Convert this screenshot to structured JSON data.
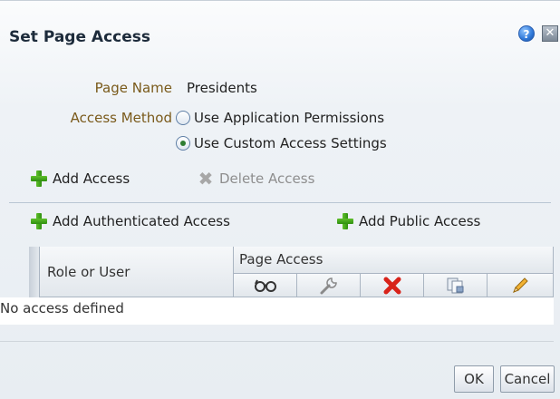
{
  "dialog": {
    "title": "Set Page Access",
    "help_icon": "question-mark-icon",
    "close_icon": "close-icon"
  },
  "form": {
    "page_name_label": "Page Name",
    "page_name_value": "Presidents",
    "access_method_label": "Access Method",
    "options": [
      {
        "label": "Use Application Permissions",
        "selected": false
      },
      {
        "label": "Use Custom Access Settings",
        "selected": true
      }
    ]
  },
  "toolbar": {
    "add_access": "Add Access",
    "delete_access": "Delete Access",
    "delete_enabled": false,
    "add_authenticated": "Add Authenticated Access",
    "add_public": "Add Public Access"
  },
  "table": {
    "col_role": "Role or User",
    "col_page_access": "Page Access",
    "privilege_icons": [
      "view-glasses-icon",
      "customize-wrench-icon",
      "delete-x-icon",
      "copy-pages-icon",
      "edit-pencil-icon"
    ],
    "empty_text": "No access defined"
  },
  "buttons": {
    "ok": "OK",
    "cancel": "Cancel"
  },
  "colors": {
    "label": "#7a5a1b",
    "accent_green": "#2f8f10",
    "delete_red": "#d8231a"
  }
}
